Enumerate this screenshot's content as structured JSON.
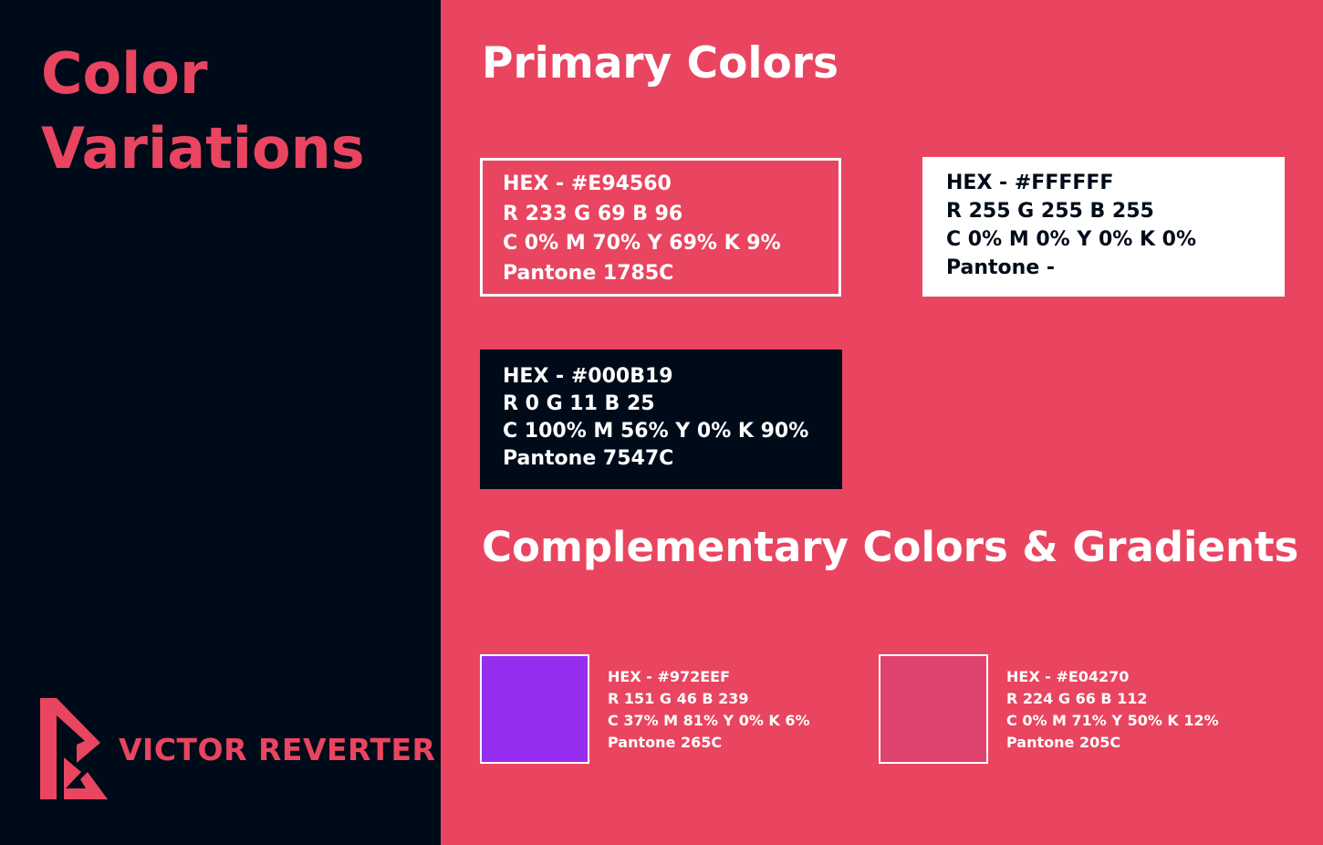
{
  "sidebar": {
    "title_lines": [
      "Color",
      "Variations"
    ],
    "brand_name": "VICTOR REVERTER",
    "logo_icon": "victor-reverter-logo-icon"
  },
  "main": {
    "primary_title": "Primary Colors",
    "primary_colors": [
      {
        "hex": "HEX - #E94560",
        "rgb": "R 233 G 69 B 96",
        "cmyk": "C 0% M 70% Y 69% K 9%",
        "pantone": "Pantone 1785C",
        "swatch_color": "#E94560"
      },
      {
        "hex": "HEX - #FFFFFF",
        "rgb": "R 255 G 255 B 255",
        "cmyk": "C 0% M 0% Y 0% K 0%",
        "pantone": "Pantone -",
        "swatch_color": "#FFFFFF"
      },
      {
        "hex": "HEX - #000B19",
        "rgb": "R 0 G 11 B 25",
        "cmyk": "C 100% M 56% Y 0% K 90%",
        "pantone": "Pantone 7547C",
        "swatch_color": "#000B19"
      }
    ],
    "complementary_title": "Complementary Colors & Gradients",
    "complementary_colors": [
      {
        "hex": "HEX - #972EEF",
        "rgb": "R 151 G 46 B 239",
        "cmyk": "C 37% M 81% Y 0% K 6%",
        "pantone": "Pantone 265C",
        "swatch_color": "#972EEF"
      },
      {
        "hex": "HEX - #E04270",
        "rgb": "R 224 G 66 B 112",
        "cmyk": "C 0% M 71% Y 50% K 12%",
        "pantone": "Pantone 205C",
        "swatch_color": "#E04270"
      }
    ]
  }
}
